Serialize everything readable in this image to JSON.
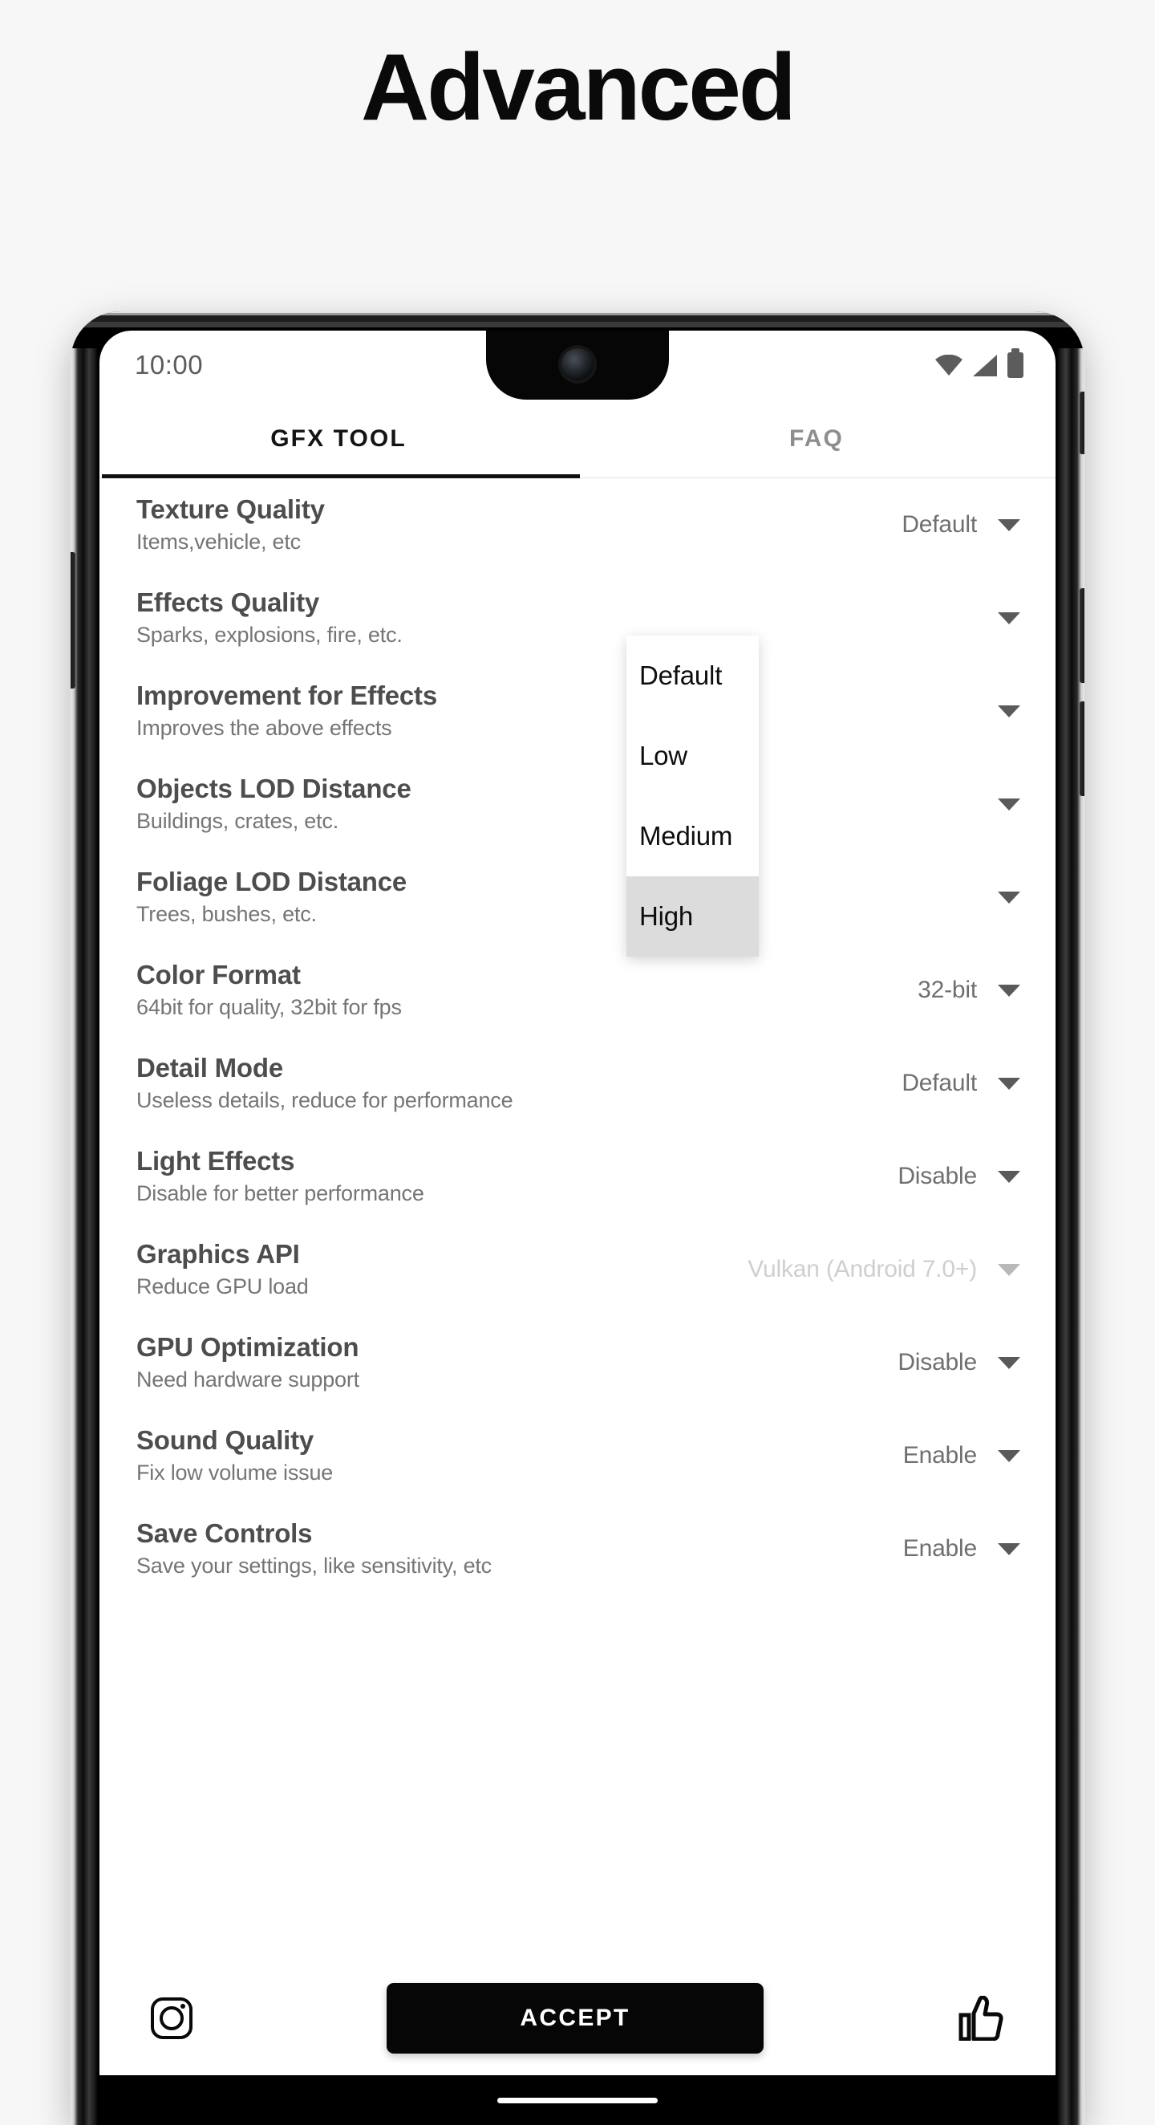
{
  "page": {
    "title": "Advanced"
  },
  "status_bar": {
    "time": "10:00",
    "icons": [
      "wifi-icon",
      "cellular-signal-icon",
      "battery-icon"
    ]
  },
  "tabs": [
    {
      "label": "GFX TOOL",
      "active": true
    },
    {
      "label": "FAQ",
      "active": false
    }
  ],
  "settings": [
    {
      "title": "Texture Quality",
      "subtitle": "Items,vehicle, etc",
      "value": "Default",
      "dim": false
    },
    {
      "title": "Effects Quality",
      "subtitle": "Sparks, explosions, fire, etc.",
      "value": "",
      "dim": false
    },
    {
      "title": "Improvement for Effects",
      "subtitle": "Improves the above effects",
      "value": "",
      "dim": false
    },
    {
      "title": "Objects LOD Distance",
      "subtitle": "Buildings, crates, etc.",
      "value": "",
      "dim": false
    },
    {
      "title": "Foliage LOD Distance",
      "subtitle": "Trees, bushes, etc.",
      "value": "",
      "dim": false
    },
    {
      "title": "Color Format",
      "subtitle": "64bit for quality, 32bit for fps",
      "value": "32-bit",
      "dim": false
    },
    {
      "title": "Detail Mode",
      "subtitle": "Useless details, reduce for performance",
      "value": "Default",
      "dim": false
    },
    {
      "title": "Light Effects",
      "subtitle": "Disable for better performance",
      "value": "Disable",
      "dim": false
    },
    {
      "title": "Graphics API",
      "subtitle": "Reduce GPU load",
      "value": "Vulkan (Android 7.0+)",
      "dim": true
    },
    {
      "title": "GPU Optimization",
      "subtitle": "Need hardware support",
      "value": "Disable",
      "dim": false
    },
    {
      "title": "Sound Quality",
      "subtitle": "Fix low volume issue",
      "value": "Enable",
      "dim": false
    },
    {
      "title": "Save Controls",
      "subtitle": "Save your settings, like sensitivity, etc",
      "value": "Enable",
      "dim": false
    }
  ],
  "dropdown": {
    "open_for": "Effects Quality",
    "options": [
      {
        "label": "Default",
        "selected": false
      },
      {
        "label": "Low",
        "selected": false
      },
      {
        "label": "Medium",
        "selected": false
      },
      {
        "label": "High",
        "selected": true
      }
    ]
  },
  "bottom_bar": {
    "instagram_label": "instagram-icon",
    "accept_label": "ACCEPT",
    "like_label": "thumbs-up-icon"
  },
  "colors": {
    "accent": "#060606",
    "title_text": "#4d4d4d",
    "subtitle_text": "#757575",
    "value_text": "#6f6f6f",
    "dim_text": "#cfcfcf",
    "selected_option_bg": "#dcdcdc"
  }
}
